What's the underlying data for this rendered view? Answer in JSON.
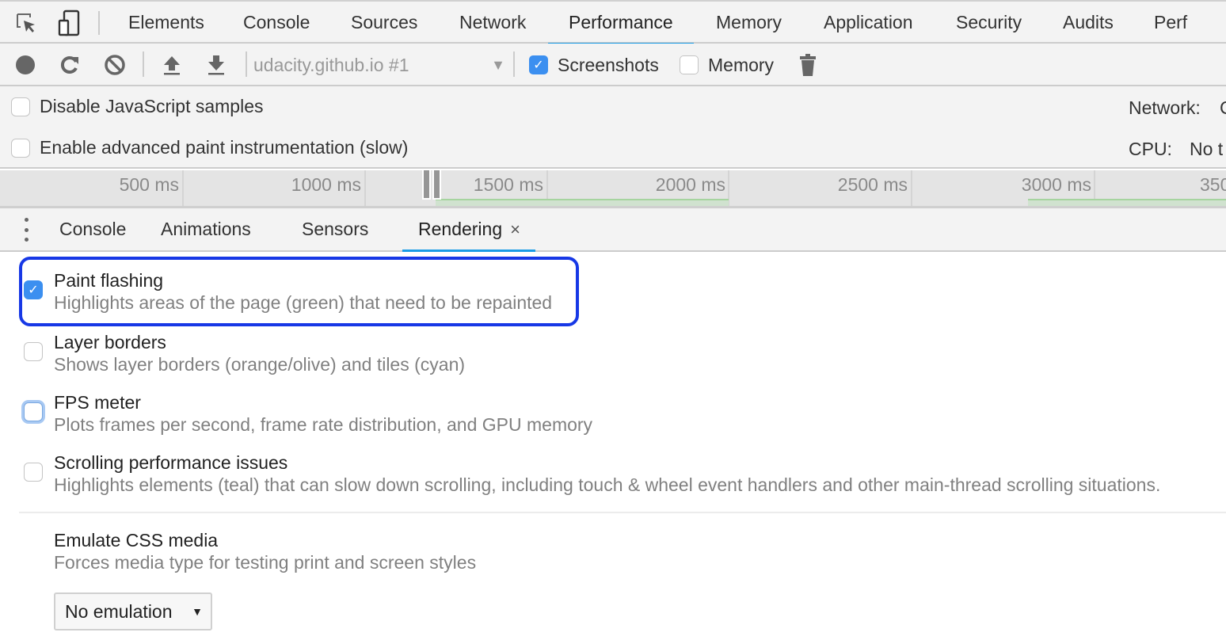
{
  "main_tabs": [
    {
      "label": "Elements",
      "active": false
    },
    {
      "label": "Console",
      "active": false
    },
    {
      "label": "Sources",
      "active": false
    },
    {
      "label": "Network",
      "active": false
    },
    {
      "label": "Performance",
      "active": true
    },
    {
      "label": "Memory",
      "active": false
    },
    {
      "label": "Application",
      "active": false
    },
    {
      "label": "Security",
      "active": false
    },
    {
      "label": "Audits",
      "active": false
    },
    {
      "label": "Perf",
      "active": false
    }
  ],
  "toolbar": {
    "icons": [
      "record-icon",
      "reload-icon",
      "clear-icon",
      "upload-icon",
      "download-icon",
      "trash-icon"
    ],
    "target": "udacity.github.io #1",
    "screenshots": {
      "label": "Screenshots",
      "checked": true
    },
    "memory": {
      "label": "Memory",
      "checked": false
    }
  },
  "settings": {
    "disable_js_samples": {
      "label": "Disable JavaScript samples",
      "checked": false
    },
    "advanced_paint": {
      "label": "Enable advanced paint instrumentation (slow)",
      "checked": false
    },
    "network_label": "Network:",
    "network_value": "C",
    "cpu_label": "CPU:",
    "cpu_value": "No t"
  },
  "timeline": {
    "ticks": [
      "500 ms",
      "1000 ms",
      "1500 ms",
      "2000 ms",
      "2500 ms",
      "3000 ms",
      "350"
    ]
  },
  "drawer_tabs": [
    {
      "label": "Console",
      "active": false
    },
    {
      "label": "Animations",
      "active": false
    },
    {
      "label": "Sensors",
      "active": false
    },
    {
      "label": "Rendering",
      "active": true,
      "closable": true
    }
  ],
  "close_glyph": "×",
  "rendering": {
    "options": [
      {
        "title": "Paint flashing",
        "desc": "Highlights areas of the page (green) that need to be repainted",
        "checked": true,
        "highlighted": true
      },
      {
        "title": "Layer borders",
        "desc": "Shows layer borders (orange/olive) and tiles (cyan)",
        "checked": false
      },
      {
        "title": "FPS meter",
        "desc": "Plots frames per second, frame rate distribution, and GPU memory",
        "checked": false,
        "focused": true
      },
      {
        "title": "Scrolling performance issues",
        "desc": "Highlights elements (teal) that can slow down scrolling, including touch & wheel event handlers and other main-thread scrolling situations.",
        "checked": false
      }
    ],
    "emulate_media": {
      "title": "Emulate CSS media",
      "desc": "Forces media type for testing print and screen styles",
      "selected": "No emulation"
    }
  },
  "colors": {
    "accent": "#1a9ce6",
    "checkbox_checked": "#3b8ff0",
    "highlight_border": "#1738e6",
    "fps_green": "#a6d49f"
  }
}
